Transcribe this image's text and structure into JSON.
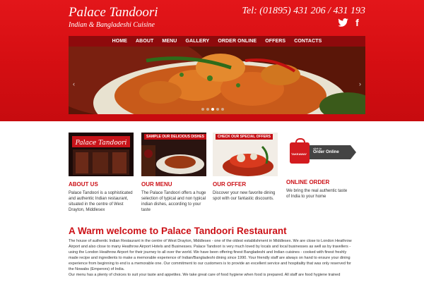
{
  "header": {
    "brand_name": "Palace Tandoori",
    "brand_tagline": "Indian & Bangladeshi Cuisine",
    "phone": "Tel: (01895) 431 206 / 431 193",
    "twitter_label": "t",
    "facebook_label": "f"
  },
  "nav": {
    "items": [
      {
        "label": "HOME"
      },
      {
        "label": "ABOUT"
      },
      {
        "label": "MENU"
      },
      {
        "label": "GALLERY"
      },
      {
        "label": "ORDER ONLINE"
      },
      {
        "label": "OFFERS"
      },
      {
        "label": "CONTACTS"
      }
    ]
  },
  "slider": {
    "prev_label": "‹",
    "next_label": "›"
  },
  "features": [
    {
      "title": "ABOUT US",
      "desc": "Palace Tandoori is a sophisticated and authentic Indian restaurant, situated in the centre of West Drayton, Middlesex"
    },
    {
      "title": "OUR MENU",
      "badge": "SAMPLE OUR DELICIOUS DISHES",
      "desc": "The Palace Tandoori offers a huge selection of typical and non typical indian dishes, according to your taste"
    },
    {
      "title": "OUR OFFER",
      "badge": "CHECK OUR SPECIAL OFFERS",
      "desc": "Discover your new favorite dining spot with our fantastic discounts."
    },
    {
      "title": "ONLINE ORDER",
      "desc": "We bring the real authentic taste of India to your home",
      "bag_label": "TAKEAWAY",
      "button_small": "click to",
      "button_label": "Order Online"
    }
  ],
  "welcome": {
    "title": "A Warm welcome to Palace Tandoori Restaurant",
    "p1": "The house of authentic Indian Restaurant in the centre of West Drayton, Middlesex - one of the oldest establishment in Middlesex. We are close to London Heathrow Airport and also close to many Heathrow Airport Hotels and Businesses. Palace Tandoori is very much loved by locals and local businesses as well as by travellers - using the London Heathrow Airport for their journey to all over the world. We have been offering finest Bangladeshi and Indian cuisines - cooked with finest freshly made recipe and ingredients to make a memorable experience of Indian/Bangladeshi dining since 1990. Your friendly staff are always on hand to ensure your dining experience from beginning to end is a memorable one. Our commitment to our customers is to provide an excellent service and hospitality that was only reserved for the Nowabs (Emperors) of India.",
    "p2": "Our menu has a plenty of choices to suit your taste and appetites. We take great care of food hygiene when food is prepared. All staff are food hygiene trained"
  }
}
